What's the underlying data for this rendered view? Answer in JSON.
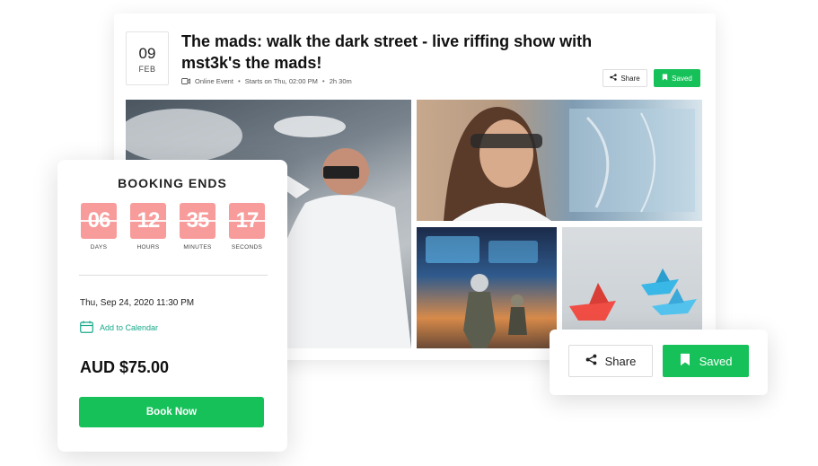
{
  "event": {
    "day": "09",
    "month": "FEB",
    "title": "The mads: walk the dark street - live riffing show with mst3k's the mads!",
    "meta_type": "Online Event",
    "meta_start": "Starts on Thu, 02:00 PM",
    "meta_duration": "2h 30m",
    "share_label": "Share",
    "saved_label": "Saved"
  },
  "booking": {
    "title": "BOOKING ENDS",
    "countdown": [
      {
        "value": "06",
        "label": "DAYS"
      },
      {
        "value": "12",
        "label": "HOURS"
      },
      {
        "value": "35",
        "label": "MINUTES"
      },
      {
        "value": "17",
        "label": "SECONDS"
      }
    ],
    "date": "Thu, Sep 24, 2020 11:30 PM",
    "add_calendar": "Add to Calendar",
    "price": "AUD $75.00",
    "book_label": "Book Now"
  },
  "share_popup": {
    "share_label": "Share",
    "saved_label": "Saved"
  },
  "colors": {
    "accent_green": "#17c15a",
    "countdown_pink": "#f79b9b",
    "calendar_teal": "#17a98a"
  }
}
